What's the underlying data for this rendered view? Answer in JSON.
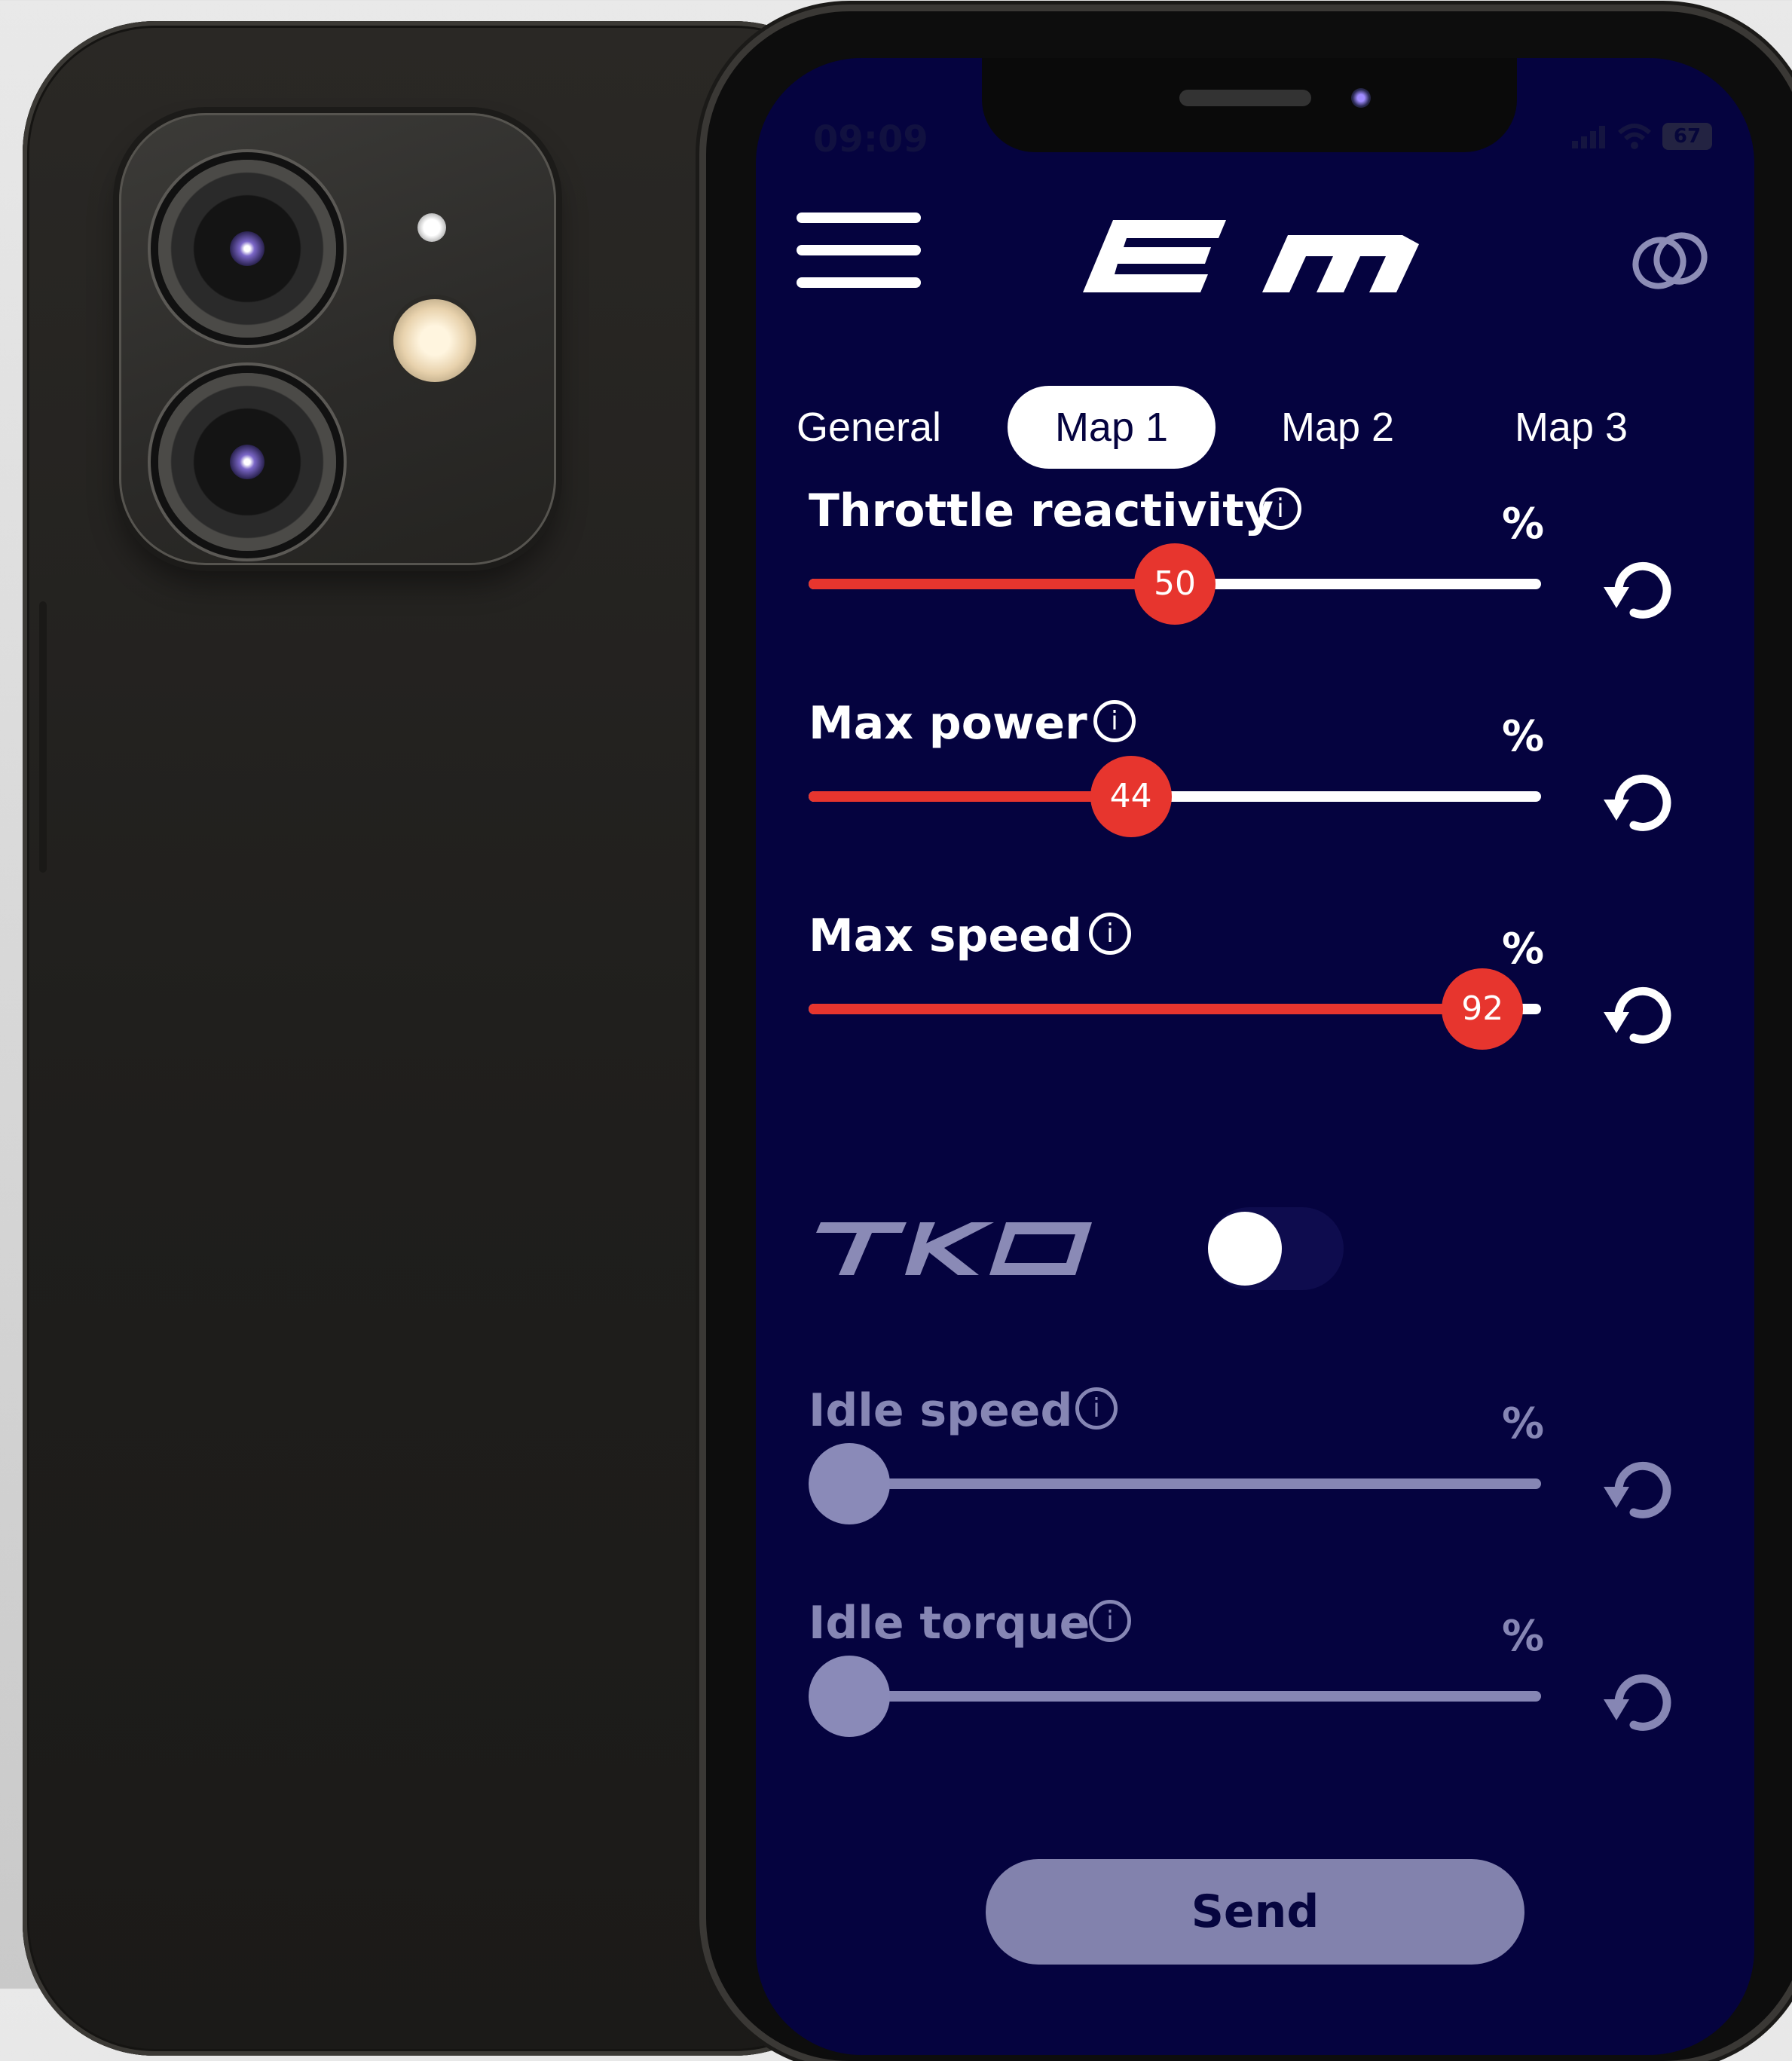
{
  "status_bar": {
    "time": "09:09",
    "battery": "67"
  },
  "header": {
    "menu_icon": "hamburger-menu-icon",
    "logo_text": "EM",
    "link_icon": "linked-rings-icon"
  },
  "tabs": [
    {
      "label": "General",
      "active": false
    },
    {
      "label": "Map 1",
      "active": true
    },
    {
      "label": "Map 2",
      "active": false
    },
    {
      "label": "Map 3",
      "active": false
    }
  ],
  "sliders": [
    {
      "label": "Throttle reactivity",
      "unit": "%",
      "value": 50,
      "enabled": true,
      "value_label": "50"
    },
    {
      "label": "Max power",
      "unit": "%",
      "value": 44,
      "enabled": true,
      "value_label": "44"
    },
    {
      "label": "Max speed",
      "unit": "%",
      "value": 92,
      "enabled": true,
      "value_label": "92"
    }
  ],
  "tko": {
    "label": "TKO",
    "enabled": false
  },
  "idle_sliders": [
    {
      "label": "Idle speed",
      "unit": "%",
      "value": 0,
      "enabled": false
    },
    {
      "label": "Idle torque",
      "unit": "%",
      "value": 0,
      "enabled": false
    }
  ],
  "send_label": "Send",
  "colors": {
    "background": "#05033f",
    "accent_red": "#e7352e",
    "disabled": "#8686b4",
    "white": "#ffffff"
  }
}
